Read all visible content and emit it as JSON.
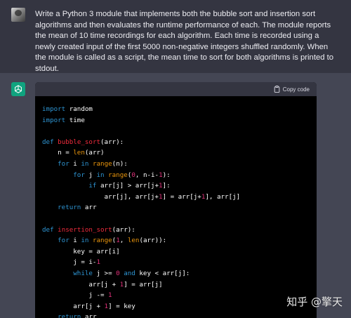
{
  "colors": {
    "page_bg": "#444654",
    "user_bg": "#343541",
    "code_bg": "#000000",
    "code_header_bg": "#343541",
    "assistant_avatar": "#10a37f",
    "keyword": "#2e95d3",
    "function_name": "#f22c3d",
    "builtin": "#e9950c",
    "number": "#df3079"
  },
  "user_message": {
    "text": "Write a Python 3 module that implements both the bubble sort and insertion sort algorithms and then evaluates the runtime performance of each. The module reports the mean of 10 time recordings for each algorithm. Each time is recorded using a newly created input of the first 5000 non-negative integers shuffled randomly. When the module is called as a script, the mean time to sort for both algorithms is printed to stdout."
  },
  "assistant": {
    "avatar_icon": "openai-logo-icon",
    "code": {
      "copy_label": "Copy code",
      "copy_icon": "clipboard-icon",
      "lines": [
        [
          {
            "t": "import",
            "c": "kw"
          },
          {
            "t": " random"
          }
        ],
        [
          {
            "t": "import",
            "c": "kw"
          },
          {
            "t": " time"
          }
        ],
        [],
        [
          {
            "t": "def",
            "c": "kw"
          },
          {
            "t": " "
          },
          {
            "t": "bubble_sort",
            "c": "fn"
          },
          {
            "t": "(arr):"
          }
        ],
        [
          {
            "t": "    n = "
          },
          {
            "t": "len",
            "c": "bi"
          },
          {
            "t": "(arr)"
          }
        ],
        [
          {
            "t": "    "
          },
          {
            "t": "for",
            "c": "kw"
          },
          {
            "t": " i "
          },
          {
            "t": "in",
            "c": "kw"
          },
          {
            "t": " "
          },
          {
            "t": "range",
            "c": "bi"
          },
          {
            "t": "(n):"
          }
        ],
        [
          {
            "t": "        "
          },
          {
            "t": "for",
            "c": "kw"
          },
          {
            "t": " j "
          },
          {
            "t": "in",
            "c": "kw"
          },
          {
            "t": " "
          },
          {
            "t": "range",
            "c": "bi"
          },
          {
            "t": "("
          },
          {
            "t": "0",
            "c": "nm"
          },
          {
            "t": ", n-i-"
          },
          {
            "t": "1",
            "c": "nm"
          },
          {
            "t": "):"
          }
        ],
        [
          {
            "t": "            "
          },
          {
            "t": "if",
            "c": "kw"
          },
          {
            "t": " arr[j] > arr[j+"
          },
          {
            "t": "1",
            "c": "nm"
          },
          {
            "t": "]:"
          }
        ],
        [
          {
            "t": "                arr[j], arr[j+"
          },
          {
            "t": "1",
            "c": "nm"
          },
          {
            "t": "] = arr[j+"
          },
          {
            "t": "1",
            "c": "nm"
          },
          {
            "t": "], arr[j]"
          }
        ],
        [
          {
            "t": "    "
          },
          {
            "t": "return",
            "c": "kw"
          },
          {
            "t": " arr"
          }
        ],
        [],
        [
          {
            "t": "def",
            "c": "kw"
          },
          {
            "t": " "
          },
          {
            "t": "insertion_sort",
            "c": "fn"
          },
          {
            "t": "(arr):"
          }
        ],
        [
          {
            "t": "    "
          },
          {
            "t": "for",
            "c": "kw"
          },
          {
            "t": " i "
          },
          {
            "t": "in",
            "c": "kw"
          },
          {
            "t": " "
          },
          {
            "t": "range",
            "c": "bi"
          },
          {
            "t": "("
          },
          {
            "t": "1",
            "c": "nm"
          },
          {
            "t": ", "
          },
          {
            "t": "len",
            "c": "bi"
          },
          {
            "t": "(arr)):"
          }
        ],
        [
          {
            "t": "        key = arr[i]"
          }
        ],
        [
          {
            "t": "        j = i-"
          },
          {
            "t": "1",
            "c": "nm"
          }
        ],
        [
          {
            "t": "        "
          },
          {
            "t": "while",
            "c": "kw"
          },
          {
            "t": " j >= "
          },
          {
            "t": "0",
            "c": "nm"
          },
          {
            "t": " "
          },
          {
            "t": "and",
            "c": "kw"
          },
          {
            "t": " key < arr[j]:"
          }
        ],
        [
          {
            "t": "            arr[j + "
          },
          {
            "t": "1",
            "c": "nm"
          },
          {
            "t": "] = arr[j]"
          }
        ],
        [
          {
            "t": "            j -= "
          },
          {
            "t": "1",
            "c": "nm"
          }
        ],
        [
          {
            "t": "        arr[j + "
          },
          {
            "t": "1",
            "c": "nm"
          },
          {
            "t": "] = key"
          }
        ],
        [
          {
            "t": "    "
          },
          {
            "t": "return",
            "c": "kw"
          },
          {
            "t": " arr"
          }
        ]
      ]
    }
  },
  "watermark": "知乎 @擎天"
}
